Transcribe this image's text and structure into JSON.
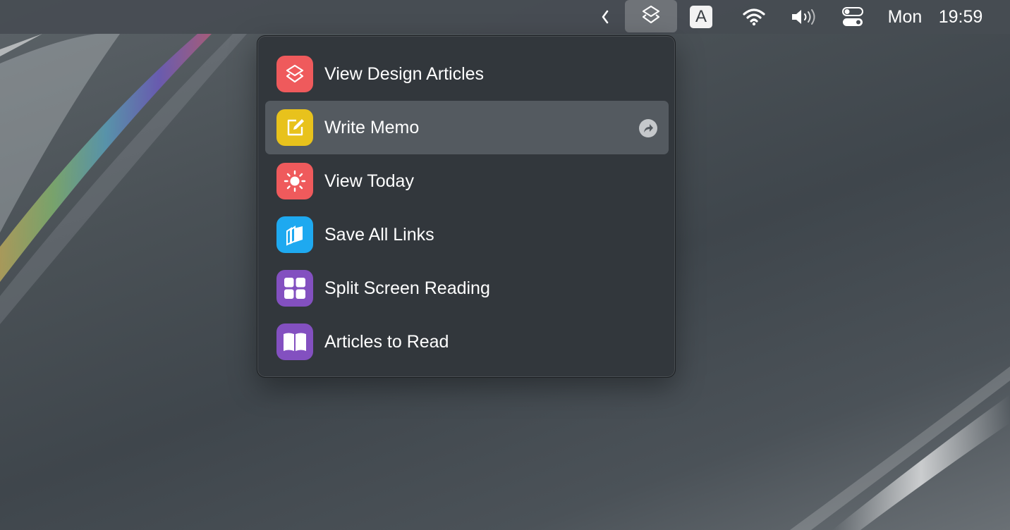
{
  "menubar": {
    "chevron_icon": "chevron-left-icon",
    "shortcuts_icon": "shortcuts-icon",
    "input_source": "A",
    "wifi_icon": "wifi-icon",
    "volume_icon": "volume-icon",
    "control_center_icon": "control-center-icon",
    "day": "Mon",
    "time": "19:59"
  },
  "menu": {
    "items": [
      {
        "label": "View Design Articles",
        "icon": "shortcuts-layers-icon",
        "color": "#ef5a5c"
      },
      {
        "label": "Write Memo",
        "icon": "compose-icon",
        "color": "#e8c21c",
        "highlighted": true,
        "trailing_icon": "share-arrow-icon"
      },
      {
        "label": "View Today",
        "icon": "sun-icon",
        "color": "#ef5a5c"
      },
      {
        "label": "Save All Links",
        "icon": "stacked-pages-icon",
        "color": "#1ea9f0"
      },
      {
        "label": "Split Screen Reading",
        "icon": "grid-icon",
        "color": "#8350c0"
      },
      {
        "label": "Articles to Read",
        "icon": "book-icon",
        "color": "#8350c0"
      }
    ]
  }
}
